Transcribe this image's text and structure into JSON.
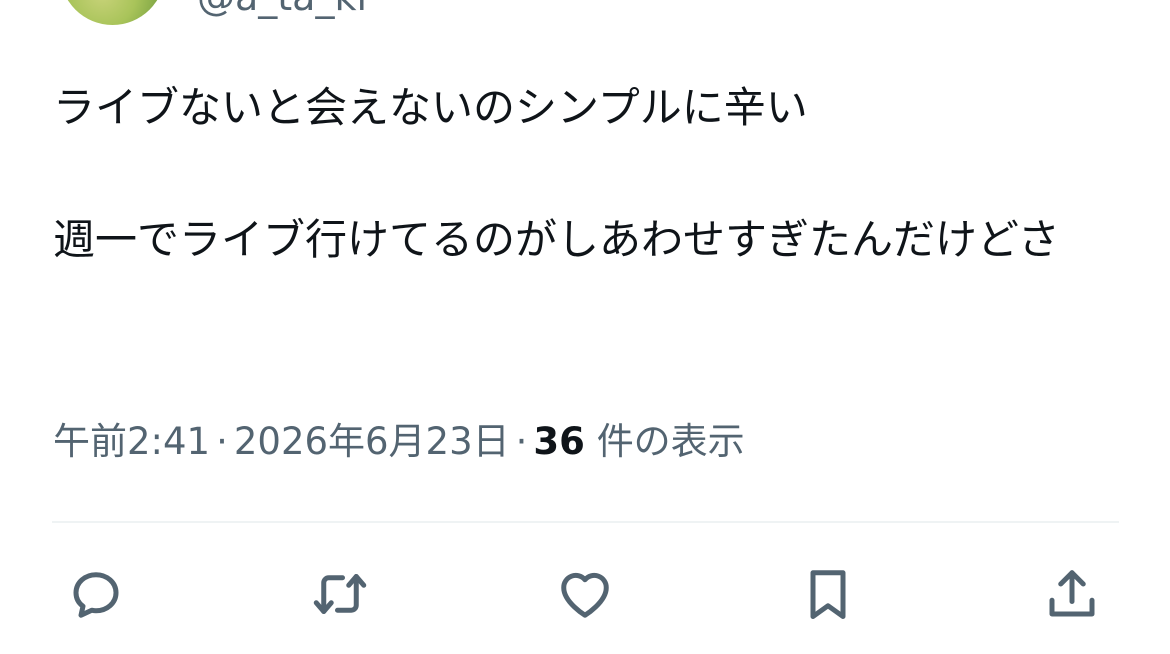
{
  "author": {
    "handle": "@a_ta_ki"
  },
  "tweet": {
    "text": "ライブないと会えないのシンプルに辛い\n\n週一でライブ行けてるのがしあわせすぎたんだけどさ"
  },
  "meta": {
    "time": "午前2:41",
    "date": "2026年6月23日",
    "separator": "·",
    "views_count": "36",
    "views_label": "件の表示"
  },
  "actions": {
    "reply_icon": "reply-icon",
    "retweet_icon": "retweet-icon",
    "like_icon": "heart-icon",
    "bookmark_icon": "bookmark-icon",
    "share_icon": "share-icon"
  },
  "colors": {
    "text": "#0f1419",
    "secondary": "#536471",
    "divider": "#eff3f4"
  }
}
